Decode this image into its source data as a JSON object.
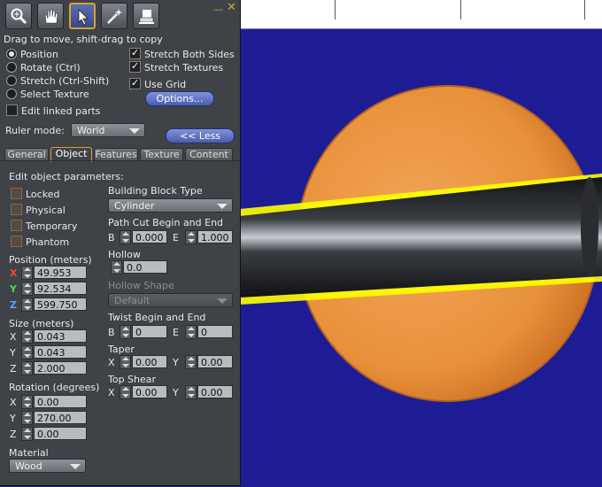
{
  "window": {
    "close_glyph": "✕",
    "minimize_glyph": "—"
  },
  "toolbar": {
    "tools": [
      {
        "name": "focus-tool",
        "icon": "magnifier-icon"
      },
      {
        "name": "move-tool",
        "icon": "grab-hand-icon"
      },
      {
        "name": "edit-tool",
        "icon": "pointer-icon",
        "selected": true
      },
      {
        "name": "create-tool",
        "icon": "magic-wand-icon"
      },
      {
        "name": "land-tool",
        "icon": "bulldozer-icon"
      }
    ]
  },
  "hint": "Drag to move, shift-drag to copy",
  "modes": [
    {
      "label": "Position",
      "selected": true
    },
    {
      "label": "Rotate (Ctrl)",
      "selected": false
    },
    {
      "label": "Stretch (Ctrl-Shift)",
      "selected": false
    },
    {
      "label": "Select Texture",
      "selected": false
    }
  ],
  "options": {
    "stretch_both_sides": {
      "label": "Stretch Both Sides",
      "checked": true
    },
    "stretch_textures": {
      "label": "Stretch Textures",
      "checked": true
    },
    "use_grid": {
      "label": "Use Grid",
      "checked": true
    },
    "options_button": "Options...",
    "edit_linked": {
      "label": "Edit linked parts",
      "checked": false
    }
  },
  "ruler": {
    "label": "Ruler mode:",
    "value": "World"
  },
  "less_button": "<< Less",
  "tabs": [
    "General",
    "Object",
    "Features",
    "Texture",
    "Content"
  ],
  "active_tab": "Object",
  "object": {
    "heading": "Edit object parameters:",
    "flags": [
      {
        "label": "Locked",
        "checked": false
      },
      {
        "label": "Physical",
        "checked": false
      },
      {
        "label": "Temporary",
        "checked": false
      },
      {
        "label": "Phantom",
        "checked": false
      }
    ],
    "position": {
      "label": "Position (meters)",
      "x": "49.953",
      "y": "92.534",
      "z": "599.750"
    },
    "size": {
      "label": "Size (meters)",
      "x": "0.043",
      "y": "0.043",
      "z": "2.000"
    },
    "rotation": {
      "label": "Rotation (degrees)",
      "x": "0.00",
      "y": "270.00",
      "z": "0.00"
    },
    "material": {
      "label": "Material",
      "value": "Wood"
    },
    "axis_labels": {
      "x": "X",
      "y": "Y",
      "z": "Z"
    },
    "building_block": {
      "label": "Building Block Type",
      "value": "Cylinder"
    },
    "path_cut": {
      "label": "Path Cut Begin and End",
      "b_label": "B",
      "e_label": "E",
      "b": "0.000",
      "e": "1.000"
    },
    "hollow": {
      "label": "Hollow",
      "value": "0.0"
    },
    "hollow_shape": {
      "label": "Hollow Shape",
      "value": "Default",
      "disabled": true
    },
    "twist": {
      "label": "Twist Begin and End",
      "b_label": "B",
      "e_label": "E",
      "b": "0",
      "e": "0"
    },
    "taper": {
      "label": "Taper",
      "x_label": "X",
      "y_label": "Y",
      "x": "0.00",
      "y": "0.00"
    },
    "top_shear": {
      "label": "Top Shear",
      "x_label": "X",
      "y_label": "Y",
      "x": "0.00",
      "y": "0.00"
    }
  },
  "colors": {
    "panel_bg": "#3f4348",
    "accent": "#d8a030",
    "button": "#5a6cc0",
    "sky": "#1e1c95",
    "sphere": "#e8913a",
    "rod": "#202226",
    "highlight": "#ffff00"
  }
}
